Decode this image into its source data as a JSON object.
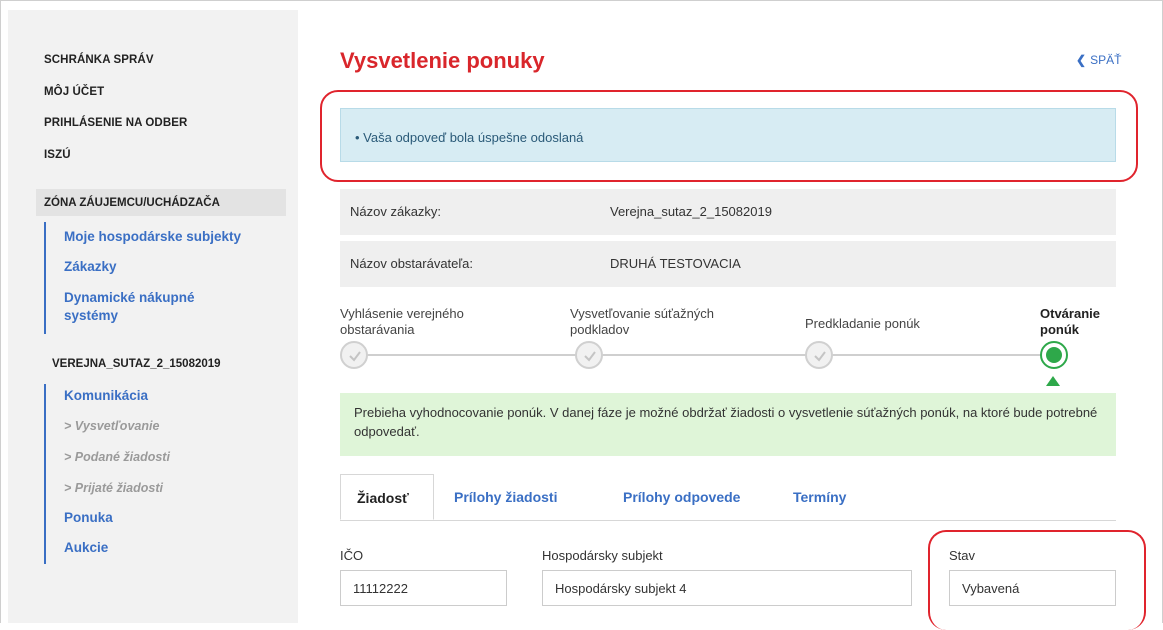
{
  "sidebar": {
    "top_links": [
      "SCHRÁNKA SPRÁV",
      "MÔJ ÚČET",
      "PRIHLÁSENIE NA ODBER",
      "ISZÚ"
    ],
    "zone_title": "ZÓNA ZÁUJEMCU/UCHÁDZAČA",
    "zone_links": [
      "Moje hospodárske subjekty",
      "Zákazky",
      "Dynamické nákupné",
      "systémy"
    ],
    "project_title": "VEREJNA_SUTAZ_2_15082019",
    "project_links": {
      "komunikacia": "Komunikácia",
      "vysvetlovanie": "> Vysvetľovanie",
      "podane": "> Podané žiadosti",
      "prijate": "> Prijaté žiadosti",
      "ponuka": "Ponuka",
      "aukcie": "Aukcie"
    }
  },
  "header": {
    "title": "Vysvetlenie ponuky",
    "back_label": "SPÄŤ"
  },
  "alert": {
    "message": "• Vaša odpoveď bola úspešne odoslaná"
  },
  "info": {
    "contract_label": "Názov zákazky:",
    "contract_value": "Verejna_sutaz_2_15082019",
    "buyer_label": "Názov obstarávateľa:",
    "buyer_value": "DRUHÁ TESTOVACIA"
  },
  "timeline": {
    "steps": [
      {
        "line1": "Vyhlásenie verejného",
        "line2": "obstarávania",
        "state": "done"
      },
      {
        "line1": "Vysvetľovanie súťažných",
        "line2": "podkladov",
        "state": "done"
      },
      {
        "line1": "",
        "line2": "Predkladanie ponúk",
        "state": "done"
      },
      {
        "line1": "Otváranie",
        "line2": "ponúk",
        "state": "active"
      }
    ],
    "colors": {
      "active": "#2ea84a",
      "done": "#d0d0d0"
    }
  },
  "phase_note": "Prebieha vyhodnocovanie ponúk. V danej fáze je možné obdržať žiadosti o vysvetlenie súťažných ponúk, na ktoré bude potrebné odpovedať.",
  "tabs": [
    "Žiadosť",
    "Prílohy žiadosti",
    "Prílohy odpovede",
    "Termíny"
  ],
  "form": {
    "ico_label": "IČO",
    "ico_value": "11112222",
    "subject_label": "Hospodársky subjekt",
    "subject_value": "Hospodársky subjekt 4",
    "status_label": "Stav",
    "status_value": "Vybavená"
  },
  "colors": {
    "accent": "#3a6fc4",
    "title": "#d9262b",
    "highlight": "#e0242d"
  }
}
